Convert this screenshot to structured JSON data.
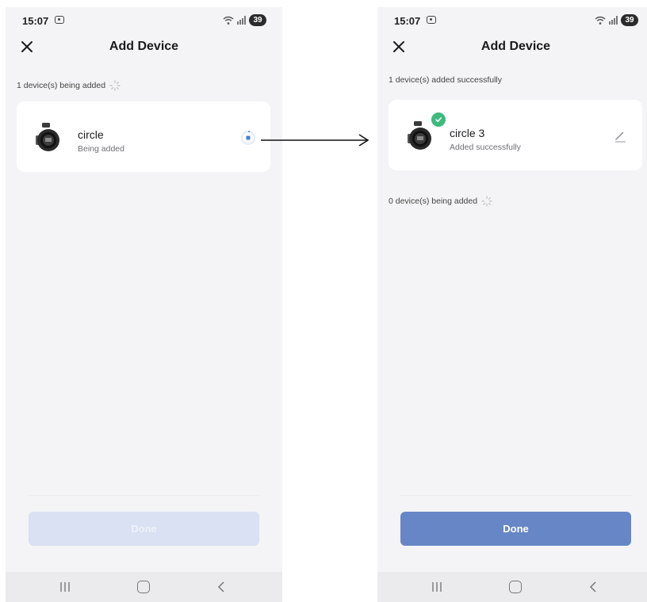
{
  "left_screen": {
    "status_bar": {
      "time": "15:07",
      "battery": "39"
    },
    "header": {
      "title": "Add Device"
    },
    "progress_label": "1 device(s) being added",
    "device": {
      "name": "circle",
      "status": "Being added"
    },
    "footer": {
      "done_label": "Done"
    }
  },
  "right_screen": {
    "status_bar": {
      "time": "15:07",
      "battery": "39"
    },
    "header": {
      "title": "Add Device"
    },
    "success_label": "1 device(s) added successfully",
    "device": {
      "name": "circle 3",
      "status": "Added successfully"
    },
    "pending_label": "0 device(s) being added",
    "footer": {
      "done_label": "Done"
    }
  },
  "icons": {
    "close": "close-icon",
    "spinner": "loading-spinner-icon",
    "progress": "progress-ring-icon",
    "edit": "pencil-icon",
    "check": "check-badge-icon",
    "nav_recent": "recent-apps-icon",
    "nav_home": "home-icon",
    "nav_back": "back-icon",
    "flow_arrow": "arrow-right-icon"
  },
  "colors": {
    "primary": "#6686c6",
    "primary_disabled": "#d9e1f2",
    "success": "#3dba7c",
    "progress": "#3f7ee0",
    "screen_bg": "#f4f4f6",
    "card_bg": "#ffffff"
  }
}
